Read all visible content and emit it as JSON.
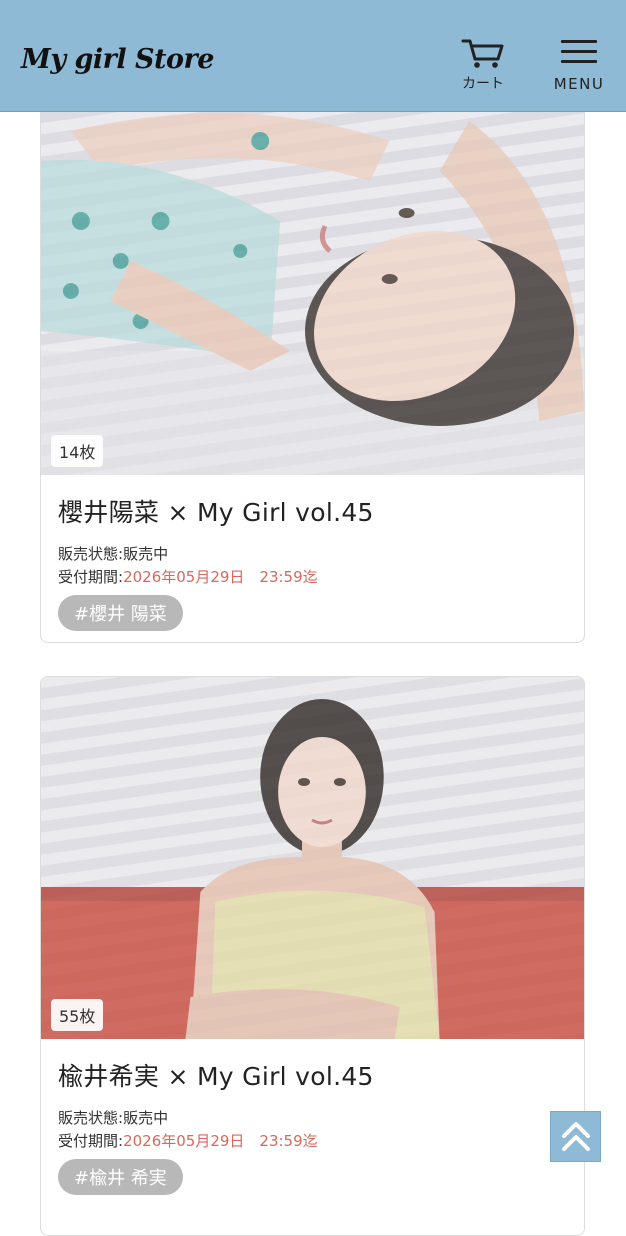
{
  "header": {
    "logo": "My girl Store",
    "cart_label": "カート",
    "menu_label": "MENU"
  },
  "cards": [
    {
      "title": "櫻井陽菜 × My Girl vol.45",
      "photo_count": "14枚",
      "status_label": "販売状態:",
      "status_value": "販売中",
      "period_label": "受付期間:",
      "period_value": "2026年05月29日　23:59迄",
      "tag": "#櫻井 陽菜"
    },
    {
      "title": "楡井希実 × My Girl vol.45",
      "photo_count": "55枚",
      "status_label": "販売状態:",
      "status_value": "販売中",
      "period_label": "受付期間:",
      "period_value": "2026年05月29日　23:59迄",
      "tag": "#楡井 希実"
    }
  ],
  "icons": {
    "cart": "cart-icon",
    "menu": "hamburger-menu-icon",
    "back_to_top": "double-chevron-up-icon"
  },
  "colors": {
    "header_bg": "#8fbad6",
    "accent_red": "#d46a5c",
    "tag_bg": "#b8b8b8"
  }
}
